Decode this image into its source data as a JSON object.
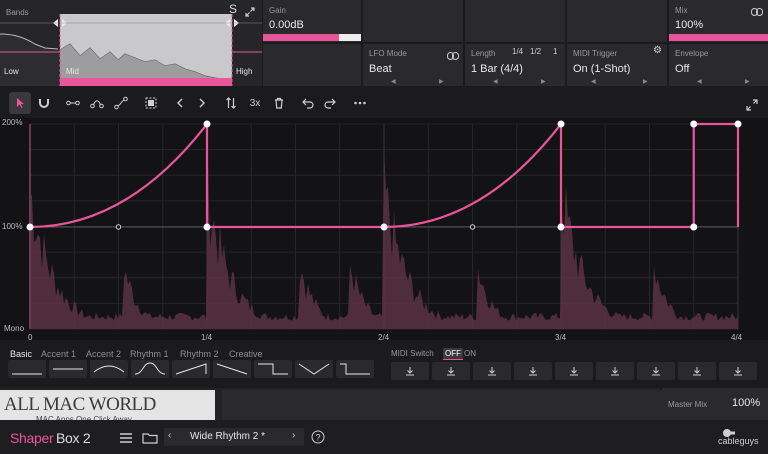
{
  "bands": {
    "label": "Bands",
    "solo": "S",
    "low": "Low",
    "mid": "Mid",
    "high": "High"
  },
  "gain": {
    "label": "Gain",
    "value": "0.00dB",
    "level": 0.78
  },
  "mix": {
    "label": "Mix",
    "value": "100%",
    "level": 1.0
  },
  "lfo_mode": {
    "label": "LFO Mode",
    "value": "Beat"
  },
  "length": {
    "label": "Length",
    "value": "1 Bar (4/4)",
    "quick": [
      "1/4",
      "1/2",
      "1"
    ]
  },
  "midi_trigger": {
    "label": "MIDI Trigger",
    "value": "On (1-Shot)"
  },
  "envelope": {
    "label": "Envelope",
    "value": "Off"
  },
  "toolbar": {
    "multiplier": "3x"
  },
  "editor": {
    "y_top": "200%",
    "y_mid": "100%",
    "y_bottom": "Mono",
    "x_ticks": [
      "0",
      "1/4",
      "2/4",
      "3/4",
      "4/4"
    ]
  },
  "presets": {
    "tabs": [
      "Basic",
      "Accent 1",
      "Accent 2",
      "Rhythm 1",
      "Rhythm 2",
      "Creative"
    ],
    "active_tab": "Basic",
    "midi_switch_label": "MIDI Switch",
    "midi_off": "OFF",
    "midi_on": "ON"
  },
  "watermark": {
    "title": "ALL MAC WORLD",
    "subtitle": "MAC Apps One Click Away"
  },
  "master_mix": {
    "label": "Master Mix",
    "value": "100%"
  },
  "footer": {
    "brand_1": "Shaper",
    "brand_2": "Box 2",
    "preset_name": "Wide Rhythm 2 *",
    "company": "cableguys"
  },
  "colors": {
    "accent": "#e8559a",
    "background": "#1b1b1d",
    "panel": "#2a2a2d"
  }
}
